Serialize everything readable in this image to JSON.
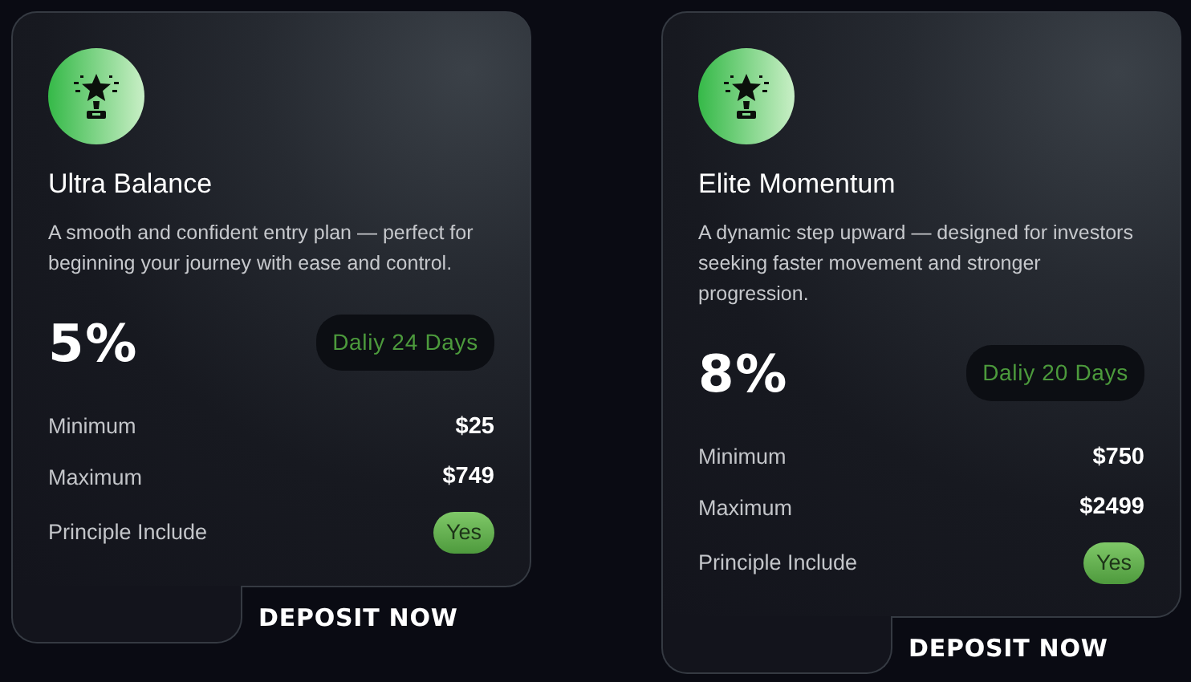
{
  "plans": [
    {
      "title": "Ultra Balance",
      "description": "A smooth and confident entry plan — perfect for beginning your journey with ease and control.",
      "rate": "5%",
      "term": "Daliy 24 Days",
      "rows": [
        {
          "kind": "amount",
          "label": "Minimum",
          "value": "$25"
        },
        {
          "kind": "amount",
          "label": "Maximum",
          "value": "$749"
        },
        {
          "kind": "badge",
          "label": "Principle Include",
          "value": "Yes"
        }
      ],
      "button": "DEPOSIT NOW"
    },
    {
      "title": "Elite Momentum",
      "description": "A dynamic step upward — designed for investors seeking faster movement and stronger progression.",
      "rate": "8%",
      "term": "Daliy 20 Days",
      "rows": [
        {
          "kind": "amount",
          "label": "Minimum",
          "value": "$750"
        },
        {
          "kind": "amount",
          "label": "Maximum",
          "value": "$2499"
        },
        {
          "kind": "badge",
          "label": "Principle Include",
          "value": "Yes"
        }
      ],
      "button": "DEPOSIT NOW"
    }
  ]
}
